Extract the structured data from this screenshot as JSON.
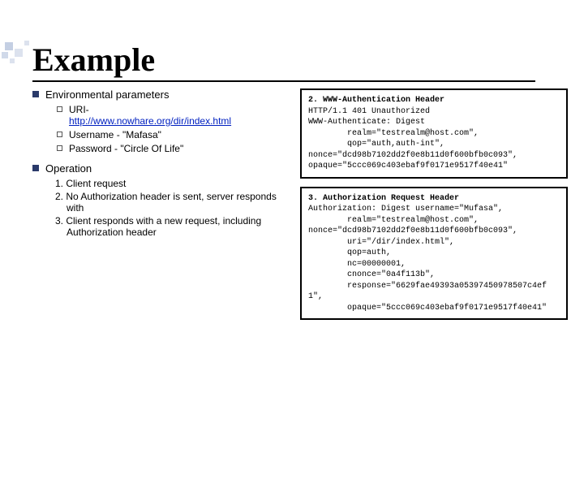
{
  "title": "Example",
  "sections": {
    "env": {
      "heading": "Environmental parameters",
      "items": {
        "uri_label": "URI-",
        "uri_link": "http://www.nowhare.org/dir/index.html",
        "username": "Username - \"Mafasa\"",
        "password": "Password - \"Circle Of Life\""
      }
    },
    "op": {
      "heading": "Operation",
      "steps": [
        "1. Client request",
        "2. No Authorization header is sent, server responds with",
        "3. Client responds with a new request, including Authorization header"
      ]
    }
  },
  "boxes": {
    "b2": {
      "title": "2. WWW-Authentication Header",
      "lines": [
        "HTTP/1.1 401 Unauthorized",
        "WWW-Authenticate: Digest",
        "        realm=\"testrealm@host.com\",",
        "        qop=\"auth,auth-int\",",
        "nonce=\"dcd98b7102dd2f0e8b11d0f600bfb0c093\",",
        "opaque=\"5ccc069c403ebaf9f0171e9517f40e41\""
      ]
    },
    "b3": {
      "title": "3. Authorization Request Header",
      "lines": [
        "Authorization: Digest username=\"Mufasa\",",
        "        realm=\"testrealm@host.com\",",
        "nonce=\"dcd98b7102dd2f0e8b11d0f600bfb0c093\",",
        "        uri=\"/dir/index.html\",",
        "        qop=auth,",
        "        nc=00000001,",
        "        cnonce=\"0a4f113b\",",
        "        response=\"6629fae49393a05397450978507c4ef1\",",
        "        opaque=\"5ccc069c403ebaf9f0171e9517f40e41\""
      ]
    }
  }
}
